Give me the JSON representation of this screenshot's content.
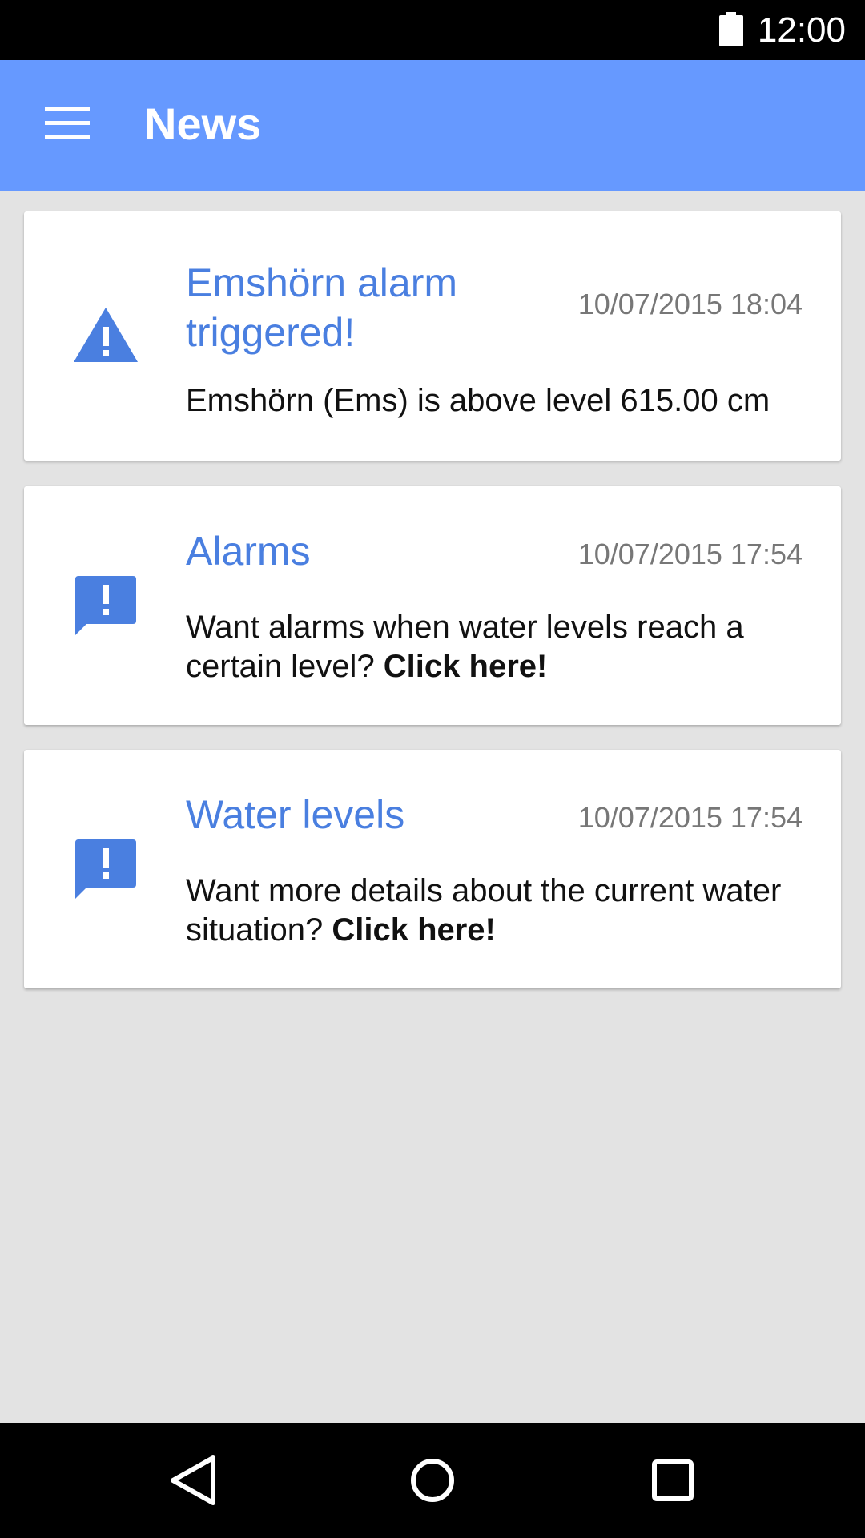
{
  "status_bar": {
    "time": "12:00",
    "battery_icon": "battery-full-icon"
  },
  "app_bar": {
    "menu_icon": "hamburger-menu-icon",
    "title": "News",
    "background_color": "#6699ff"
  },
  "news": [
    {
      "icon": "warning-icon",
      "title": "Emshörn alarm triggered!",
      "date": "10/07/2015 18:04",
      "body": "Emshörn (Ems) is above level 615.00 cm",
      "link_label": ""
    },
    {
      "icon": "feedback-message-icon",
      "title": "Alarms",
      "date": "10/07/2015 17:54",
      "body": "Want alarms when water levels reach a certain level? ",
      "link_label": "Click here!"
    },
    {
      "icon": "feedback-message-icon",
      "title": "Water levels",
      "date": "10/07/2015 17:54",
      "body": "Want more details about the current water situation? ",
      "link_label": "Click here!"
    }
  ],
  "nav_bar": {
    "back_icon": "back-triangle-icon",
    "home_icon": "home-circle-icon",
    "recents_icon": "recents-square-icon"
  },
  "colors": {
    "accent": "#4a7fe0",
    "background": "#e3e3e3",
    "date_text": "#777777"
  }
}
